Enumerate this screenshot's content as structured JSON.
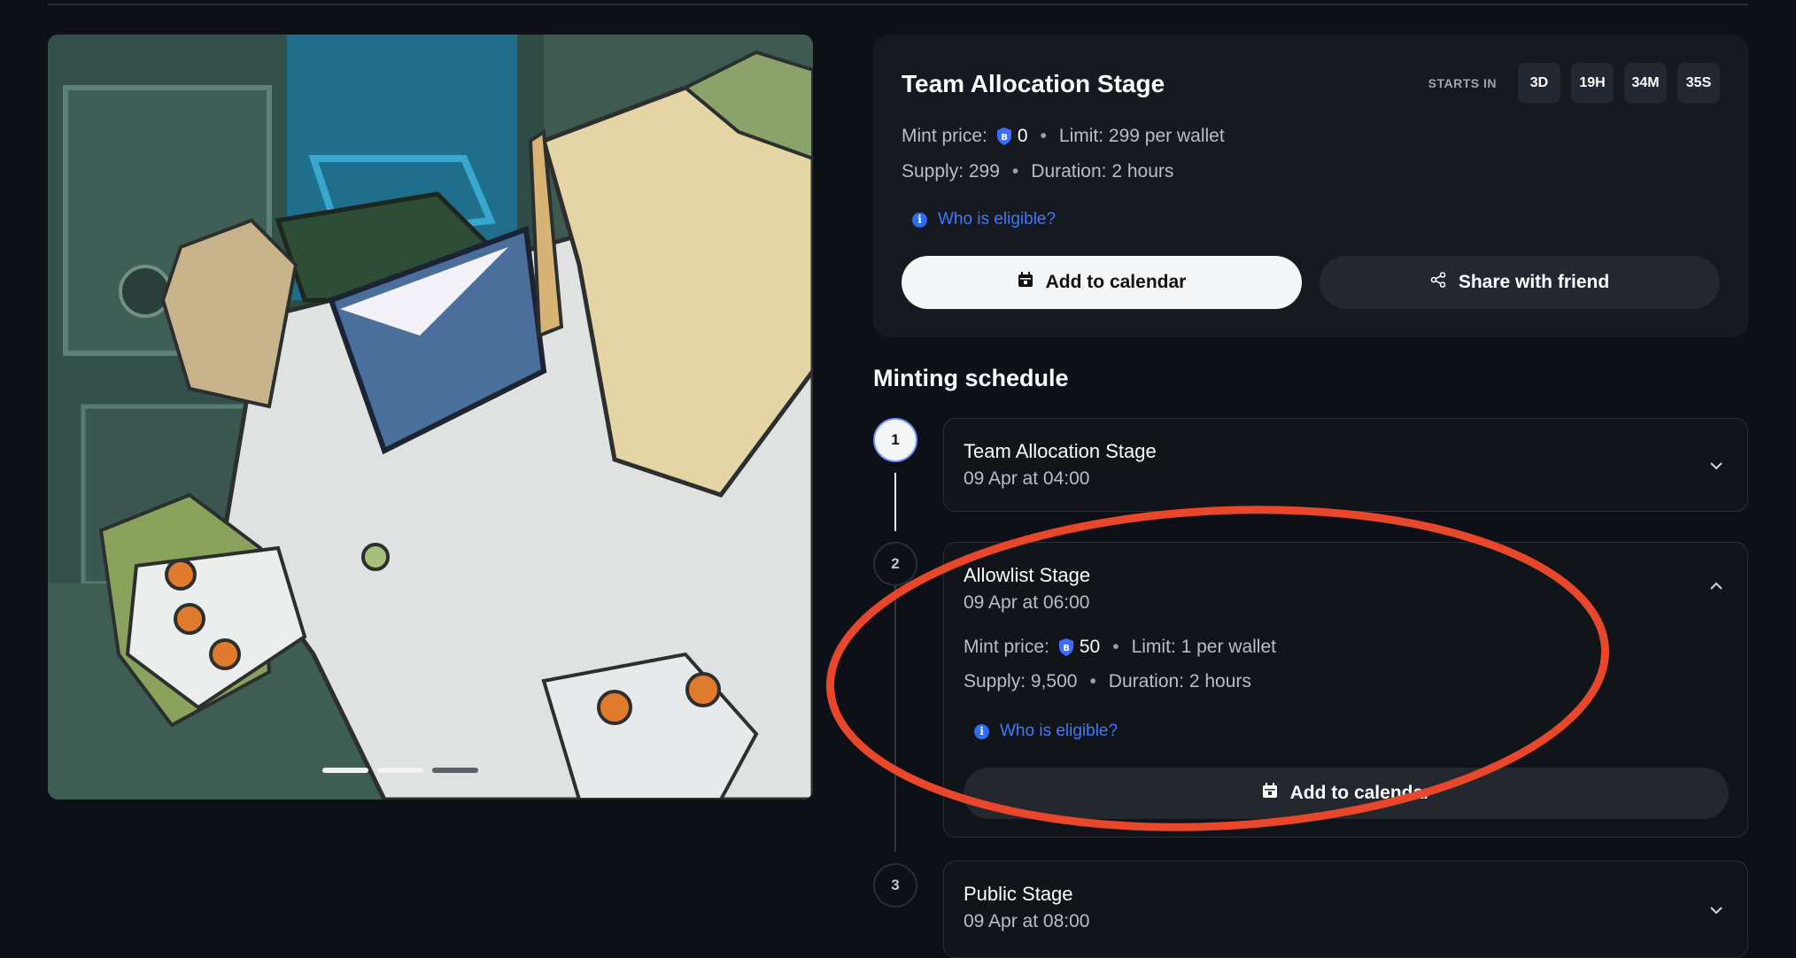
{
  "stage": {
    "title": "Team Allocation Stage",
    "starts_label": "STARTS IN",
    "countdown": [
      "3D",
      "19H",
      "34M",
      "35S"
    ],
    "mint_price_label": "Mint price:",
    "mint_price_value": "0",
    "limit": "Limit: 299 per wallet",
    "supply": "Supply: 299",
    "duration": "Duration: 2 hours",
    "eligible_link": "Who is eligible?",
    "add_calendar": "Add to calendar",
    "share": "Share with friend"
  },
  "schedule": {
    "title": "Minting schedule",
    "steps": [
      {
        "number": "1",
        "name": "Team Allocation Stage",
        "date": "09 Apr at 04:00",
        "expanded": false
      },
      {
        "number": "2",
        "name": "Allowlist Stage",
        "date": "09 Apr at 06:00",
        "expanded": true,
        "mint_price_label": "Mint price:",
        "mint_price_value": "50",
        "limit": "Limit: 1 per wallet",
        "supply": "Supply: 9,500",
        "duration": "Duration: 2 hours",
        "eligible_link": "Who is eligible?",
        "add_calendar": "Add to calendar"
      },
      {
        "number": "3",
        "name": "Public Stage",
        "date": "09 Apr at 08:00",
        "expanded": false
      }
    ]
  },
  "carousel": {
    "slides": 3,
    "active_index": 1
  },
  "colors": {
    "background": "#0d1016",
    "card": "#16191f",
    "link": "#3d7bff",
    "annotation": "#e8472b"
  },
  "icons": [
    "token-shield-icon",
    "info-icon",
    "calendar-icon",
    "share-icon",
    "chevron-down-icon",
    "chevron-up-icon"
  ]
}
